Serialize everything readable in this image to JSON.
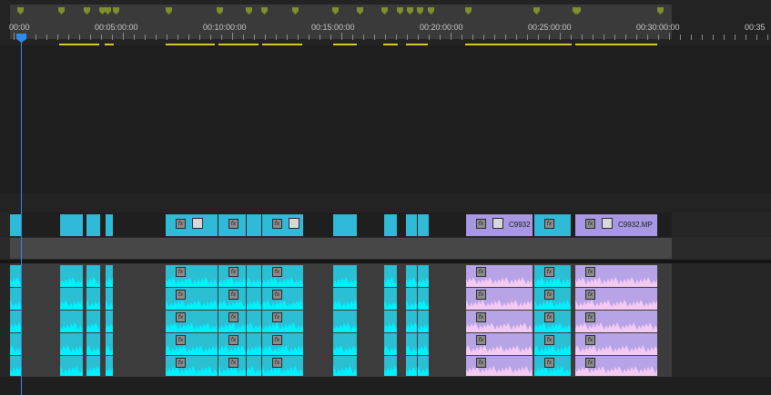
{
  "timeline": {
    "timecodes": [
      "00:00",
      "00:05:00:00",
      "00:10:00:00",
      "00:15:00:00",
      "00:20:00:00",
      "00:25:00:00",
      "00:30:00:00",
      "00:35"
    ],
    "clip_names": [
      "C9932",
      "C9932.MP"
    ],
    "playhead_icon": "playhead-icon",
    "effect_icon": "fx-badge-icon",
    "colors": {
      "video_clip": "#2fbbd7",
      "video_clip_linked": "#a897e3",
      "audio_clip": "#2bbfd4",
      "audio_clip_linked": "#b7a4e6",
      "playhead": "#2d8ceb",
      "marker": "#7f8f2c",
      "render_bar": "#d6c82a"
    }
  }
}
